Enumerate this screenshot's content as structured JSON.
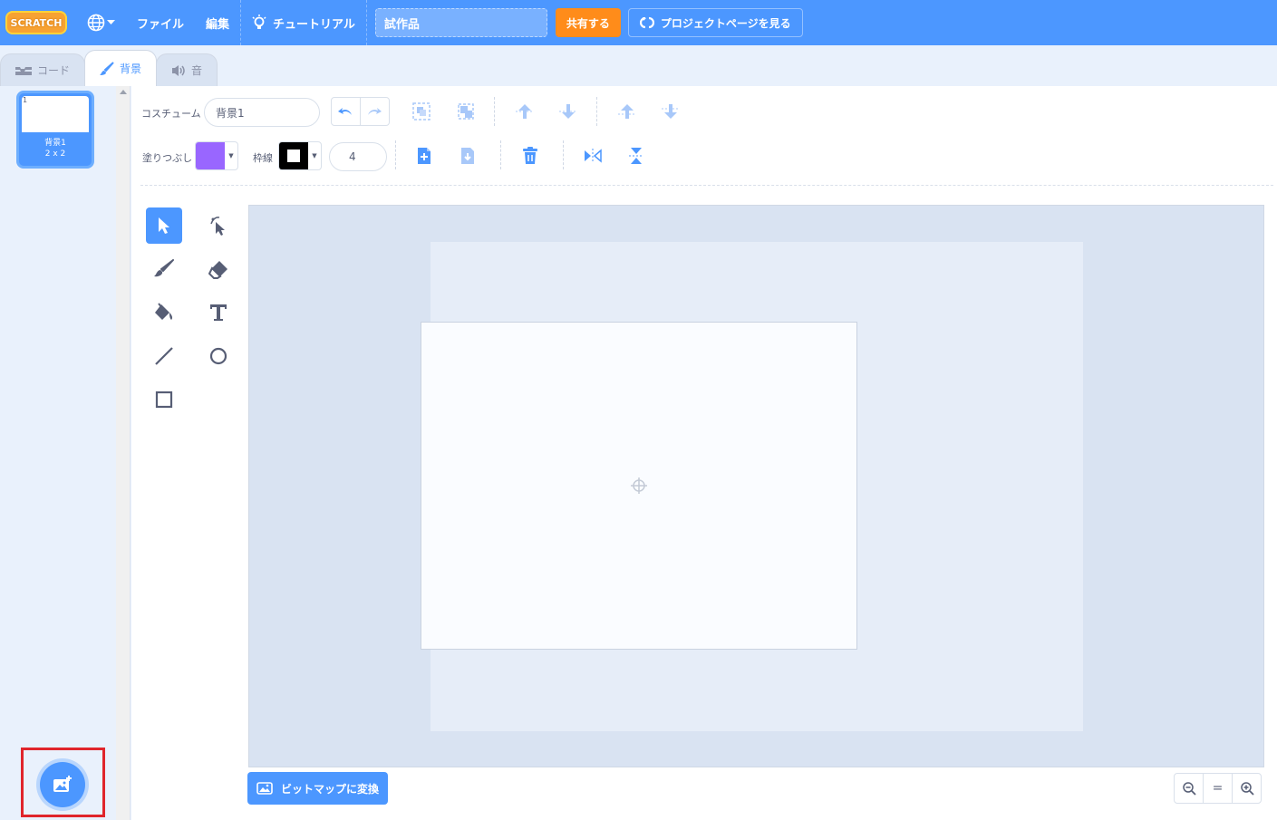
{
  "menubar": {
    "logo_text": "SCRATCH",
    "file_label": "ファイル",
    "edit_label": "編集",
    "tutorial_label": "チュートリアル",
    "project_title": "試作品",
    "share_label": "共有する",
    "project_page_label": "プロジェクトページを見る"
  },
  "tabs": [
    {
      "label": "コード"
    },
    {
      "label": "背景"
    },
    {
      "label": "音"
    }
  ],
  "costumes": [
    {
      "number": "1",
      "name": "背景1",
      "size": "2 x 2"
    }
  ],
  "editor": {
    "costume_label": "コスチューム",
    "costume_name": "背景1",
    "fill_label": "塗りつぶし",
    "outline_label": "枠線",
    "stroke_width": "4",
    "fill_color": "#9966ff",
    "outline_color": "#000000",
    "convert_bitmap_label": "ビットマップに変換",
    "zoom_reset_label": "="
  },
  "colors": {
    "accent": "#4c97ff",
    "share": "#ff8c1a",
    "highlight": "#e0252b"
  }
}
